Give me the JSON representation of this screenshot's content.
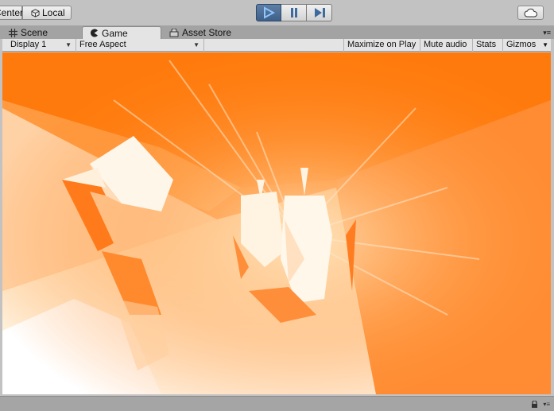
{
  "toolbar": {
    "pivot_label": "Center",
    "space_label": "Local",
    "play_icon": "play-icon",
    "pause_icon": "pause-icon",
    "step_icon": "step-icon",
    "cloud_icon": "cloud-icon",
    "accent_color": "#4a6c96"
  },
  "tabs": [
    {
      "label": "Scene",
      "icon": "grid-icon"
    },
    {
      "label": "Game",
      "icon": "pacman-icon"
    },
    {
      "label": "Asset Store",
      "icon": "store-icon"
    }
  ],
  "game_bar": {
    "display": "Display 1",
    "aspect": "Free Aspect",
    "maximize_label": "Maximize on Play",
    "mute_label": "Mute audio",
    "stats_label": "Stats",
    "gizmos_label": "Gizmos"
  },
  "viewport": {
    "background_color": "#ff8a2e",
    "highlight_color": "#fff6e6"
  }
}
